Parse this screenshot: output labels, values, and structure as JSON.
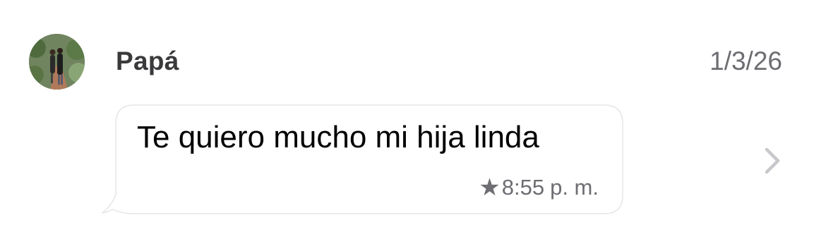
{
  "conversation": {
    "sender_name": "Papá",
    "date": "1/3/26",
    "avatar_icon": "contact-photo",
    "message": {
      "text": "Te quiero mucho mi hija linda",
      "starred": true,
      "star_icon": "star-icon",
      "time": "8:55",
      "ampm": "p. m."
    },
    "chevron_icon": "chevron-right-icon"
  },
  "colors": {
    "text_primary": "#000000",
    "text_secondary": "#6d6d72",
    "bubble_border": "#e5e5ea",
    "chevron": "#c7c7cc"
  }
}
